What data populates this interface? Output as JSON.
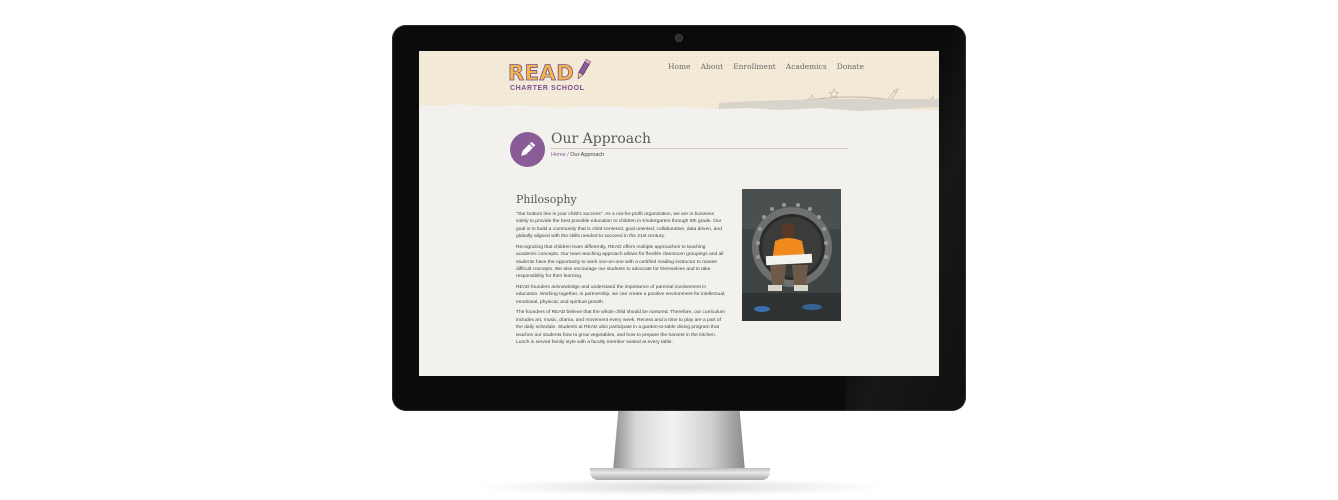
{
  "logo": {
    "name": "READ",
    "subtitle": "CHARTER SCHOOL"
  },
  "nav": {
    "items": [
      "Home",
      "About",
      "Enrollment",
      "Academics",
      "Donate"
    ]
  },
  "page": {
    "title": "Our Approach",
    "breadcrumb": {
      "home": "Home",
      "separator": " / ",
      "current": "Our Approach"
    }
  },
  "content": {
    "heading": "Philosophy",
    "paragraphs": [
      "\"Our bottom line is your child's success\". As a not-for-profit organization, we are in business solely to provide the best possible education to children in Kindergarten through 8th grade. Our goal is to build a community that is child-centered, goal oriented, collaborative, data driven, and globally aligned with the skills needed to succeed in the 21st century.",
      "Recognizing that children learn differently, READ offers multiple approaches to teaching academic concepts. Our team teaching approach allows for flexible classroom groupings and all students have the opportunity to work one-on-one with a certified reading instructor to master difficult concepts. We also encourage our students to advocate for themselves and to take responsibility for their learning.",
      "READ founders acknowledge and understand the importance of parental involvement in education. Working together, in partnership, we can create a positive environment for intellectual, emotional, physical, and spiritual growth.",
      "The founders of READ believe that the whole child should be nurtured. Therefore, our curriculum includes art, music, drama, and movement every week. Recess and a time to play are a part of the daily schedule. Students at READ also participate in a garden-to-table dining program that teaches our students how to grow vegetables, and how to prepare the harvest in the kitchen. Lunch is served family style with a faculty member seated at every table."
    ]
  },
  "colors": {
    "accent": "#8a5c97",
    "logo_fill": "#f2b84a",
    "header_bg": "#f3ead8",
    "page_bg": "#f2f1ee"
  },
  "icons": [
    "pencil-icon",
    "star-doodle-icon",
    "rocket-doodle-icon"
  ]
}
